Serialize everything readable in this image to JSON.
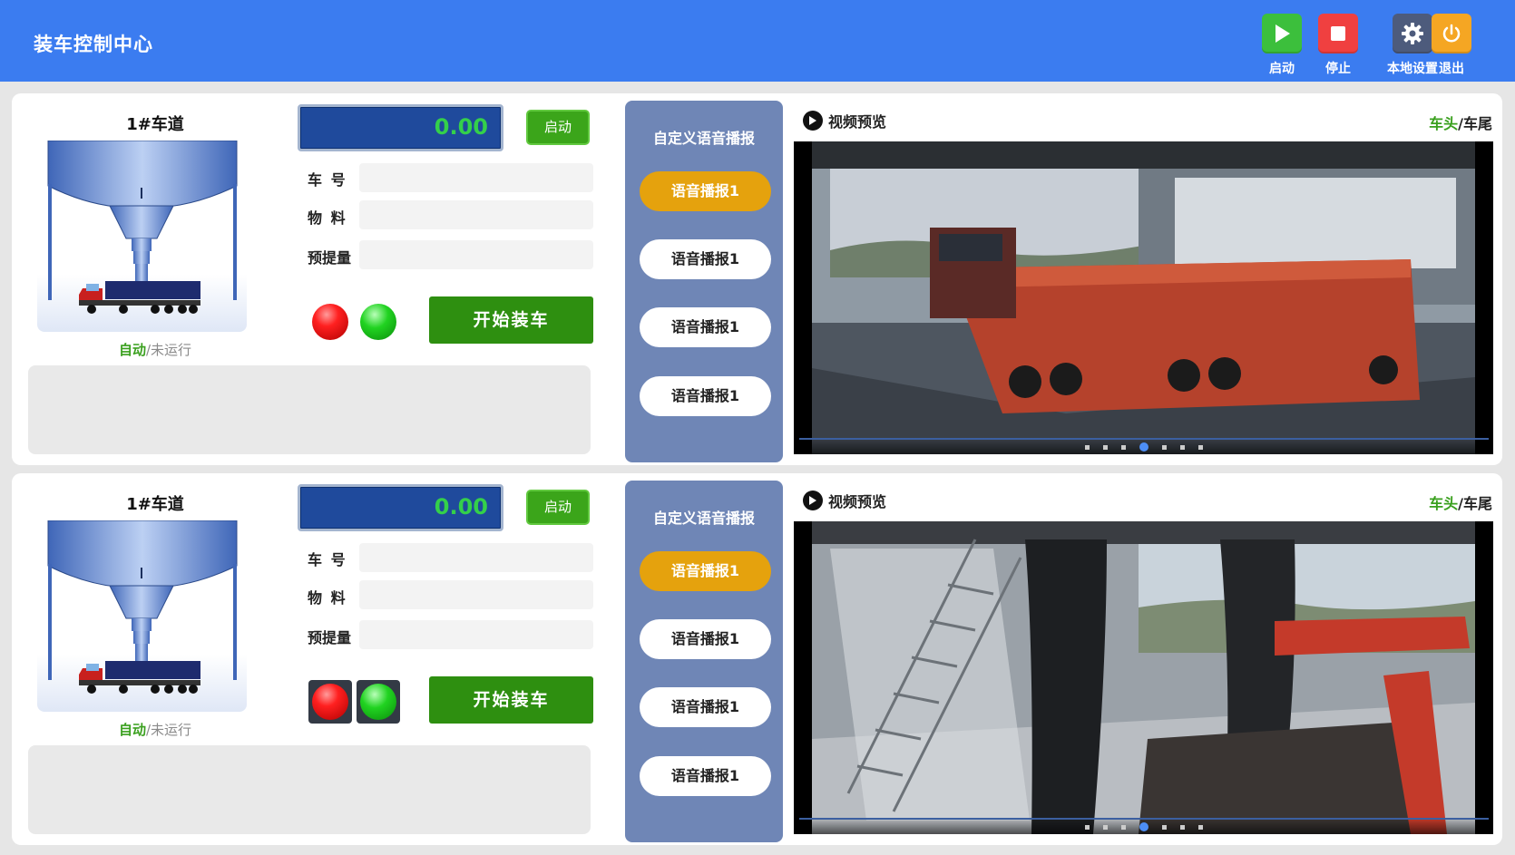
{
  "app": {
    "title": "装车控制中心"
  },
  "toolbar": {
    "start": {
      "label": "启动",
      "icon": "play-icon",
      "color": "#3cbf3c"
    },
    "stop": {
      "label": "停止",
      "icon": "stop-icon",
      "color": "#f04040"
    },
    "settings": {
      "label": "本地设置",
      "icon": "gear-icon",
      "color": "#4d5b7c"
    },
    "exit": {
      "label": "退出",
      "icon": "power-icon",
      "color": "#f5a623"
    }
  },
  "colors": {
    "header": "#3b7cf0",
    "accent_green": "#3aa01e",
    "voice_panel": "#6f86b6",
    "voice_active": "#e5a20d",
    "weight_bg": "#1f4a9c",
    "weight_text": "#34d04a"
  },
  "lanes": [
    {
      "title": "1#车道",
      "status_mode": "自动",
      "status_sep": "/",
      "status_run": "未运行",
      "weight": "0.00",
      "start_label": "启动",
      "fields": {
        "plate_label": "车 号",
        "plate_value": "",
        "material_label": "物 料",
        "material_value": "",
        "quantity_label": "预提量",
        "quantity_value": ""
      },
      "start_loading_label": "开始装车",
      "voice": {
        "title": "自定义语音播报",
        "buttons": [
          "语音播报1",
          "语音播报1",
          "语音播报1",
          "语音播报1"
        ]
      },
      "video": {
        "title": "视频预览",
        "cam_front": "车头",
        "cam_sep": "/",
        "cam_rear": "车尾"
      }
    },
    {
      "title": "1#车道",
      "status_mode": "自动",
      "status_sep": "/",
      "status_run": "未运行",
      "weight": "0.00",
      "start_label": "启动",
      "fields": {
        "plate_label": "车 号",
        "plate_value": "",
        "material_label": "物 料",
        "material_value": "",
        "quantity_label": "预提量",
        "quantity_value": ""
      },
      "start_loading_label": "开始装车",
      "voice": {
        "title": "自定义语音播报",
        "buttons": [
          "语音播报1",
          "语音播报1",
          "语音播报1",
          "语音播报1"
        ]
      },
      "video": {
        "title": "视频预览",
        "cam_front": "车头",
        "cam_sep": "/",
        "cam_rear": "车尾"
      }
    }
  ]
}
